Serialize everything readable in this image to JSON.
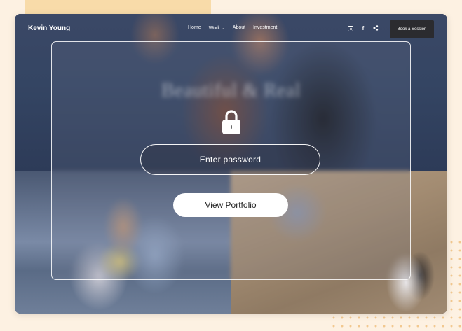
{
  "brand": "Kevin Young",
  "nav": {
    "home": "Home",
    "work": "Work",
    "about": "About",
    "investment": "Investment"
  },
  "socials": [
    "instagram-icon",
    "facebook-icon",
    "share-icon"
  ],
  "book_label": "Book a Session",
  "hero_title": "Beautiful & Real",
  "password_placeholder": "Enter password",
  "view_label": "View Portfolio",
  "colors": {
    "page_bg": "#fdf1e2",
    "accent": "#f8dba9",
    "book_button": "#2b2b2f",
    "dots": "#f2c88f"
  }
}
